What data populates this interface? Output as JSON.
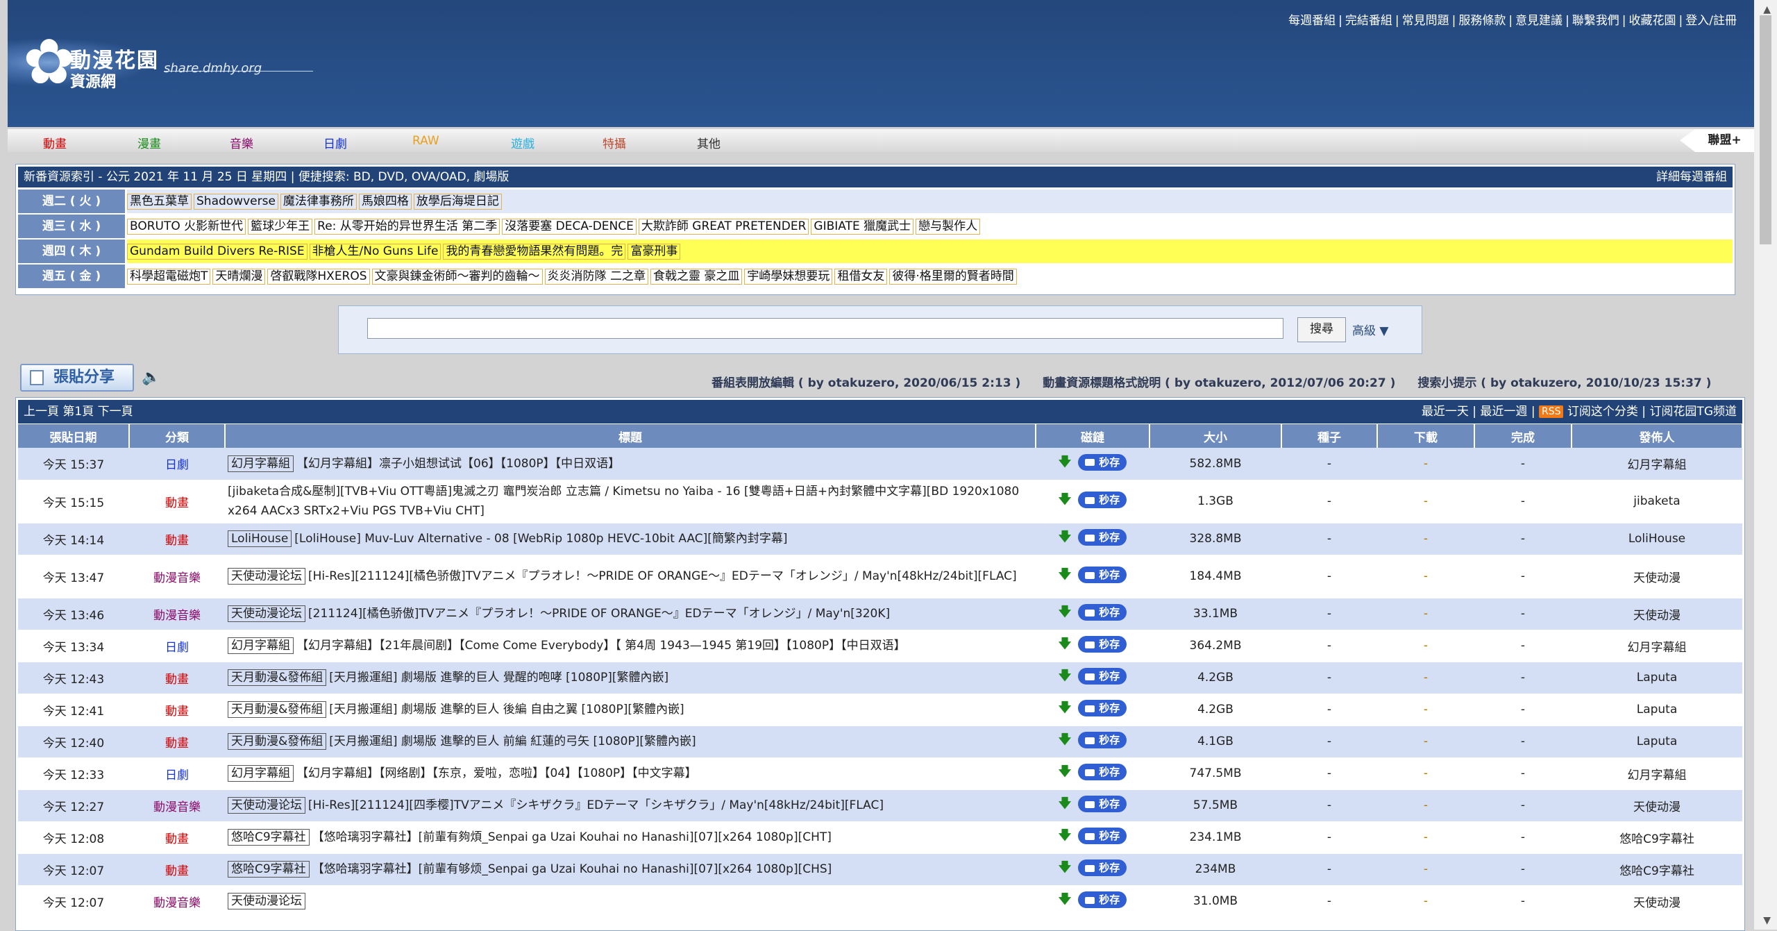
{
  "site": {
    "name": "動漫花園",
    "sub": "資源網",
    "domain": "share.dmhy.org"
  },
  "top_links": [
    "每週番組",
    "完結番組",
    "常見問題",
    "服務條款",
    "意見建議",
    "聯繫我們",
    "收藏花園",
    "登入/註冊"
  ],
  "nav": {
    "items": [
      {
        "label": "動畫",
        "color": "#d30000"
      },
      {
        "label": "漫畫",
        "color": "#1a8a1a"
      },
      {
        "label": "音樂",
        "color": "#8b0a6a"
      },
      {
        "label": "日劇",
        "color": "#1432d8"
      },
      {
        "label": "RAW",
        "color": "#e8a020"
      },
      {
        "label": "遊戲",
        "color": "#2ab0e0"
      },
      {
        "label": "特攝",
        "color": "#c04a30"
      },
      {
        "label": "其他",
        "color": "#333333"
      }
    ],
    "alliance": "聯盟+"
  },
  "weekly": {
    "title": "新番資源索引 - 公元 2021 年 11 月 25 日 星期四 | 便捷搜索: BD, DVD, OVA/OAD, 劇場版",
    "detail_link": "詳細每週番組",
    "rows": [
      {
        "day": "週二 ( 火 )",
        "style": "alt",
        "shows": [
          "黑色五葉草",
          "Shadowverse",
          "魔法律事務所",
          "馬娘四格",
          "放學后海堤日記"
        ]
      },
      {
        "day": "週三 ( 水 )",
        "style": "plain",
        "shows": [
          "BORUTO 火影新世代",
          "籃球少年王",
          "Re: 从零开始的异世界生活 第二季",
          "沒落要塞 DECA-DENCE",
          "大欺詐師 GREAT PRETENDER",
          "GIBIATE 獵魔武士",
          "戀与製作人"
        ]
      },
      {
        "day": "週四 ( 木 )",
        "style": "hl",
        "shows": [
          "Gundam Build Divers Re-RISE",
          "非槍人生/No Guns Life",
          "我的青春戀愛物語果然有問題。完",
          "富豪刑事"
        ]
      },
      {
        "day": "週五 ( 金 )",
        "style": "plain",
        "shows": [
          "科學超電磁炮T",
          "天晴爛漫",
          "啓叡戰隊HXEROS",
          "文豪與鍊金術師～審判的齒輪～",
          "炎炎消防隊 二之章",
          "食戟之靈 豪之皿",
          "宇崎學妹想要玩",
          "租借女友",
          "彼得·格里爾的賢者時間"
        ]
      }
    ]
  },
  "search": {
    "value": "",
    "button": "搜尋",
    "advanced": "高級 ▼"
  },
  "post": {
    "label": "張貼分享"
  },
  "notices": [
    "番組表開放編輯 ( by otakuzero, 2020/06/15 2:13 )",
    "動畫資源標題格式說明 ( by otakuzero, 2012/07/06 20:27 )",
    "搜索小提示 ( by otakuzero, 2010/10/23 15:37 )"
  ],
  "list_bar": {
    "pager": "上一頁 第1頁 下一頁",
    "last_day": "最近一天",
    "last_week": "最近一週",
    "rss": "RSS",
    "subscribe": "订阅这个分类",
    "tg": "订阅花园TG频道"
  },
  "columns": [
    "張貼日期",
    "分類",
    "標題",
    "磁鏈",
    "大小",
    "種子",
    "下載",
    "完成",
    "發佈人"
  ],
  "save_label": "秒存",
  "rows": [
    {
      "date": "今天 15:37",
      "cat": "日劇",
      "cat_class": "cat-blue",
      "group": "幻月字幕組",
      "title": "【幻月字幕組】凛子小姐想试试【06】【1080P】【中日双语】",
      "size": "582.8MB",
      "seeds": "-",
      "dl": "-",
      "done": "-",
      "user": "幻月字幕組",
      "tall": false
    },
    {
      "date": "今天 15:15",
      "cat": "動畫",
      "cat_class": "cat-red",
      "group": "",
      "title": "[jibaketa合成&壓制][TVB+Viu OTT粵語]鬼滅之刃 竈門炭治郎 立志篇 / Kimetsu no Yaiba - 16 [雙粵語+日語+內封繁體中文字幕][BD 1920x1080 x264 AACx3 SRTx2+Viu PGS TVB+Viu CHT]",
      "size": "1.3GB",
      "seeds": "-",
      "dl": "-",
      "done": "-",
      "user": "jibaketa",
      "tall": true
    },
    {
      "date": "今天 14:14",
      "cat": "動畫",
      "cat_class": "cat-red",
      "group": "LoliHouse",
      "title": "[LoliHouse] Muv-Luv Alternative - 08 [WebRip 1080p HEVC-10bit AAC][簡繁內封字幕]",
      "size": "328.8MB",
      "seeds": "-",
      "dl": "-",
      "done": "-",
      "user": "LoliHouse",
      "tall": false
    },
    {
      "date": "今天 13:47",
      "cat": "動漫音樂",
      "cat_class": "cat-music",
      "group": "天使动漫论坛",
      "title": "[Hi-Res][211124][橘色骄傲]TVアニメ『プラオレ！～PRIDE OF ORANGE～』EDテーマ「オレンジ」/ May'n[48kHz/24bit][FLAC]",
      "size": "184.4MB",
      "seeds": "-",
      "dl": "-",
      "done": "-",
      "user": "天使动漫",
      "tall": true
    },
    {
      "date": "今天 13:46",
      "cat": "動漫音樂",
      "cat_class": "cat-music",
      "group": "天使动漫论坛",
      "title": "[211124][橘色骄傲]TVアニメ『プラオレ！～PRIDE OF ORANGE～』EDテーマ「オレンジ」/ May'n[320K]",
      "size": "33.1MB",
      "seeds": "-",
      "dl": "-",
      "done": "-",
      "user": "天使动漫",
      "tall": false
    },
    {
      "date": "今天 13:34",
      "cat": "日劇",
      "cat_class": "cat-blue",
      "group": "幻月字幕組",
      "title": "【幻月字幕組】【21年晨间剧】【Come Come Everybody】【 第4周 1943—1945 第19回】【1080P】【中日双语】",
      "size": "364.2MB",
      "seeds": "-",
      "dl": "-",
      "done": "-",
      "user": "幻月字幕組",
      "tall": false
    },
    {
      "date": "今天 12:43",
      "cat": "動畫",
      "cat_class": "cat-red",
      "group": "天月動漫&發佈組",
      "title": "[天月搬運組] 劇場版 進擊的巨人 覺醒的咆哮 [1080P][繁體內嵌]",
      "size": "4.2GB",
      "seeds": "-",
      "dl": "-",
      "done": "-",
      "user": "Laputa",
      "tall": false
    },
    {
      "date": "今天 12:41",
      "cat": "動畫",
      "cat_class": "cat-red",
      "group": "天月動漫&發佈組",
      "title": "[天月搬運組] 劇場版 進擊的巨人 後編 自由之翼 [1080P][繁體內嵌]",
      "size": "4.2GB",
      "seeds": "-",
      "dl": "-",
      "done": "-",
      "user": "Laputa",
      "tall": false
    },
    {
      "date": "今天 12:40",
      "cat": "動畫",
      "cat_class": "cat-red",
      "group": "天月動漫&發佈組",
      "title": "[天月搬運組] 劇場版 進擊的巨人 前編 紅蓮的弓矢 [1080P][繁體內嵌]",
      "size": "4.1GB",
      "seeds": "-",
      "dl": "-",
      "done": "-",
      "user": "Laputa",
      "tall": false
    },
    {
      "date": "今天 12:33",
      "cat": "日劇",
      "cat_class": "cat-blue",
      "group": "幻月字幕組",
      "title": "【幻月字幕組】【网络剧】【东京，爱啦，恋啦】【04】【1080P】【中文字幕】",
      "size": "747.5MB",
      "seeds": "-",
      "dl": "-",
      "done": "-",
      "user": "幻月字幕組",
      "tall": false
    },
    {
      "date": "今天 12:27",
      "cat": "動漫音樂",
      "cat_class": "cat-music",
      "group": "天使动漫论坛",
      "title": "[Hi-Res][211124][四季樱]TVアニメ『シキザクラ』EDテーマ「シキザクラ」/ May'n[48kHz/24bit][FLAC]",
      "size": "57.5MB",
      "seeds": "-",
      "dl": "-",
      "done": "-",
      "user": "天使动漫",
      "tall": false
    },
    {
      "date": "今天 12:08",
      "cat": "動畫",
      "cat_class": "cat-red",
      "group": "悠哈C9字幕社",
      "title": "【悠哈璃羽字幕社】[前輩有夠煩_Senpai ga Uzai Kouhai no Hanashi][07][x264 1080p][CHT]",
      "size": "234.1MB",
      "seeds": "-",
      "dl": "-",
      "done": "-",
      "user": "悠哈C9字幕社",
      "tall": false
    },
    {
      "date": "今天 12:07",
      "cat": "動畫",
      "cat_class": "cat-red",
      "group": "悠哈C9字幕社",
      "title": "【悠哈璃羽字幕社】[前輩有够烦_Senpai ga Uzai Kouhai no Hanashi][07][x264 1080p][CHS]",
      "size": "234MB",
      "seeds": "-",
      "dl": "-",
      "done": "-",
      "user": "悠哈C9字幕社",
      "tall": false
    },
    {
      "date": "今天 12:07",
      "cat": "動漫音樂",
      "cat_class": "cat-music",
      "group": "天使动漫论坛",
      "title": "",
      "size": "31.0MB",
      "seeds": "-",
      "dl": "-",
      "done": "-",
      "user": "天使动漫",
      "tall": false
    }
  ]
}
